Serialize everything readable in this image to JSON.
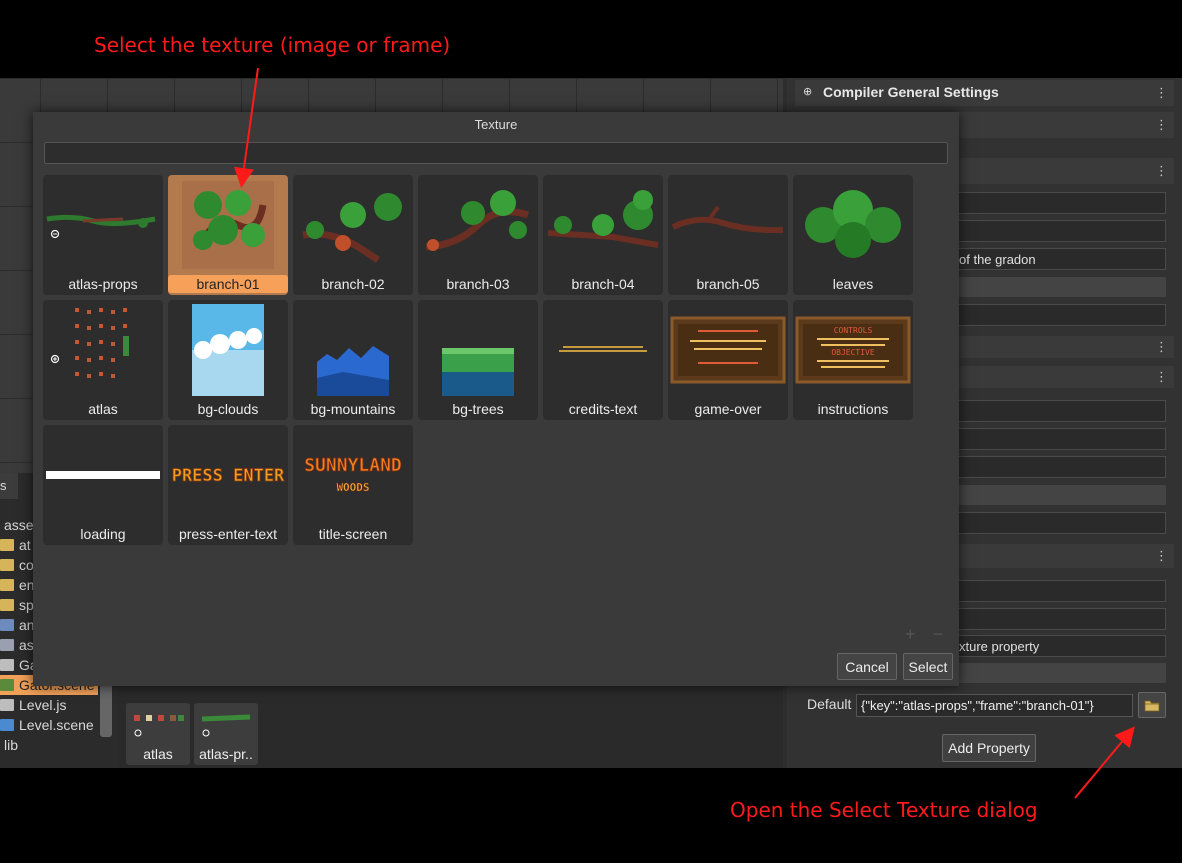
{
  "annotations": {
    "top": "Select the texture (image or frame)",
    "bottom": "Open the Select Texture dialog"
  },
  "editor": {
    "left_tab": "s",
    "tree": [
      {
        "label": "asse",
        "type": "text"
      },
      {
        "label": "at",
        "type": "folder"
      },
      {
        "label": "co",
        "type": "folder"
      },
      {
        "label": "en",
        "type": "folder"
      },
      {
        "label": "sp",
        "type": "folder"
      },
      {
        "label": "an",
        "type": "file"
      },
      {
        "label": "as",
        "type": "file"
      },
      {
        "label": "Gator.js",
        "type": "file"
      },
      {
        "label": "Gator.scene",
        "type": "file",
        "selected": true
      },
      {
        "label": "Level.js",
        "type": "file"
      },
      {
        "label": "Level.scene",
        "type": "file"
      },
      {
        "label": "lib",
        "type": "text"
      }
    ],
    "bottom_thumbs": [
      "atlas",
      "atlas-pr.."
    ]
  },
  "right_panel": {
    "section_title": "Compiler General Settings",
    "fields": [
      "of the gradon",
      "xture property"
    ],
    "default_label": "Default",
    "default_value": "{\"key\":\"atlas-props\",\"frame\":\"branch-01\"}",
    "add_property": "Add Property",
    "menu_glyph": "⋮"
  },
  "dialog": {
    "title": "Texture",
    "filter_placeholder": "",
    "items": [
      "atlas-props",
      "branch-01",
      "branch-02",
      "branch-03",
      "branch-04",
      "branch-05",
      "leaves",
      "atlas",
      "bg-clouds",
      "bg-mountains",
      "bg-trees",
      "credits-text",
      "game-over",
      "instructions",
      "loading",
      "press-enter-text",
      "title-screen"
    ],
    "selected": "branch-01",
    "title_screen_text": [
      "SUNNYLAND",
      "WOODS"
    ],
    "press_enter_text": "PRESS ENTER",
    "controls_text": [
      "CONTROLS",
      "OBJECTIVE"
    ],
    "zoom_controls": "+ −",
    "cancel": "Cancel",
    "select": "Select"
  },
  "colors": {
    "selection": "#f7a05a",
    "annotation": "#ff1a1a"
  }
}
